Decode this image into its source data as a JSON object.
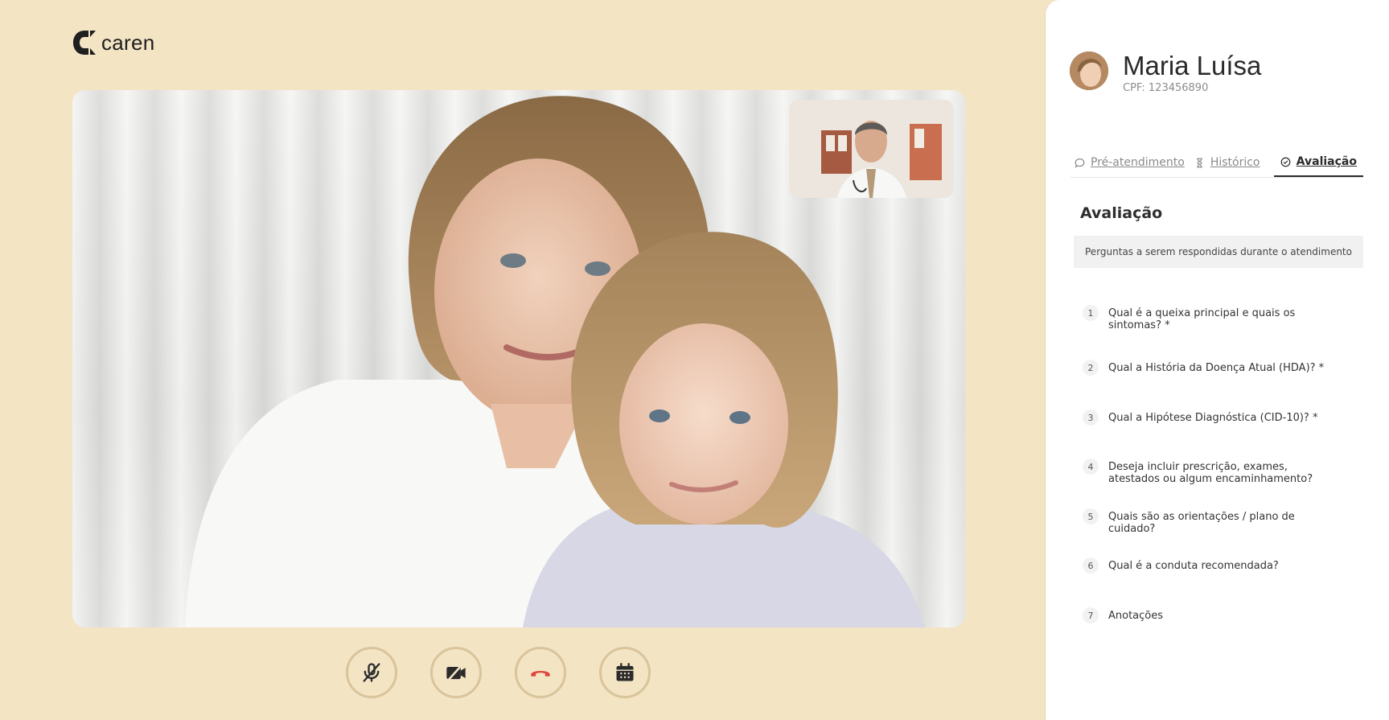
{
  "brand": {
    "name": "caren"
  },
  "patient": {
    "name": "Maria Luísa",
    "id_text": "CPF: 123456890"
  },
  "tabs": [
    {
      "label": "Pré-atendimento",
      "icon": "chat-bubble-icon",
      "active": false
    },
    {
      "label": "Histórico",
      "icon": "hourglass-icon",
      "active": false
    },
    {
      "label": "Avaliação",
      "icon": "check-circle-icon",
      "active": true
    }
  ],
  "evaluation": {
    "title": "Avaliação",
    "info": "Perguntas a serem respondidas durante o atendimento",
    "questions": [
      {
        "num": "1",
        "text": "Qual é a queixa principal e quais os sintomas? *"
      },
      {
        "num": "2",
        "text": "Qual a História da Doença Atual (HDA)? *"
      },
      {
        "num": "3",
        "text": "Qual a Hipótese Diagnóstica (CID-10)? *"
      },
      {
        "num": "4",
        "text": "Deseja incluir prescrição, exames, atestados ou algum encaminhamento?"
      },
      {
        "num": "5",
        "text": "Quais são as orientações / plano de cuidado?"
      },
      {
        "num": "6",
        "text": "Qual é a conduta recomendada?"
      },
      {
        "num": "7",
        "text": "Anotações"
      }
    ]
  },
  "controls": [
    {
      "icon": "mic-off-icon"
    },
    {
      "icon": "camera-off-icon"
    },
    {
      "icon": "end-call-icon",
      "color": "#e0433a"
    },
    {
      "icon": "calendar-icon"
    }
  ],
  "colors": {
    "background": "#f3e4c4",
    "panel": "#ffffff",
    "control_ring": "#d9c49b",
    "end_call": "#e0433a"
  }
}
